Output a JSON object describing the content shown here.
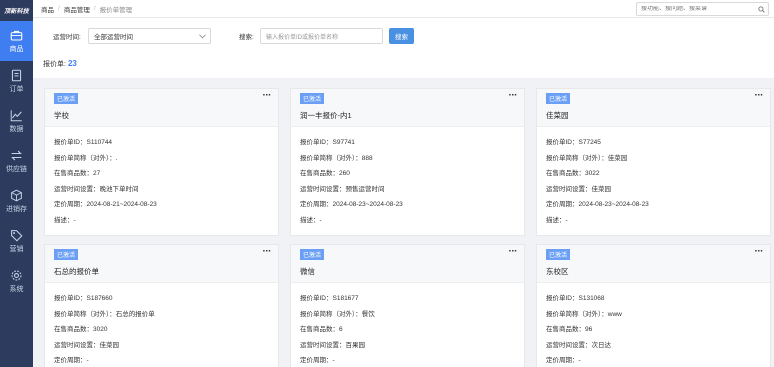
{
  "sidebar": {
    "logo": "顶新科技",
    "items": [
      {
        "label": "商品",
        "icon": "briefcase-icon",
        "active": true
      },
      {
        "label": "订单",
        "icon": "document-icon",
        "active": false
      },
      {
        "label": "数据",
        "icon": "line-chart-icon",
        "active": false
      },
      {
        "label": "供应链",
        "icon": "swap-icon",
        "active": false
      },
      {
        "label": "进销存",
        "icon": "box-icon",
        "active": false
      },
      {
        "label": "营销",
        "icon": "tag-icon",
        "active": false
      },
      {
        "label": "系统",
        "icon": "gear-icon",
        "active": false
      }
    ]
  },
  "breadcrumb": [
    "商品",
    "商品管理",
    "报价单管理"
  ],
  "top_search": {
    "placeholder": "搜功能、搜问题、搜菜谱"
  },
  "filters": {
    "period_label": "运营时间:",
    "period_value": "全部运营时间",
    "search_label": "搜索:",
    "search_placeholder": "输入报价单ID或报价单名称",
    "search_button": "搜索"
  },
  "count": {
    "label": "报价单:",
    "value": "23"
  },
  "cards": [
    {
      "status": "已激活",
      "more": "···",
      "title": "学校",
      "rows": [
        "报价单ID：S110744",
        "报价单简称（对外）：.",
        "在售商品数：27",
        "运营时间设置：晚池下单时间",
        "定价周期：2024-08-21~2024-08-23",
        "描述：-"
      ]
    },
    {
      "status": "已激活",
      "more": "···",
      "title": "润一丰报价-内1",
      "rows": [
        "报价单ID：S97741",
        "报价单简称（对外）：888",
        "在售商品数：260",
        "运营时间设置：预售运营时间",
        "定价周期：2024-08-23~2024-08-23",
        "描述：-"
      ]
    },
    {
      "status": "已激活",
      "more": "···",
      "title": "佳菜园",
      "rows": [
        "报价单ID：S77245",
        "报价单简称（对外）：佳菜园",
        "在售商品数：3022",
        "运营时间设置：佳菜园",
        "定价周期：2024-08-23~2024-08-23",
        "描述：-"
      ]
    },
    {
      "status": "已激活",
      "more": "···",
      "title": "石总的报价单",
      "rows": [
        "报价单ID：S187660",
        "报价单简称（对外）：石总的报价单",
        "在售商品数：3020",
        "运营时间设置：佳菜园",
        "定价周期：-"
      ]
    },
    {
      "status": "已激活",
      "more": "···",
      "title": "微信",
      "rows": [
        "报价单ID：S181677",
        "报价单简称（对外）：餐饮",
        "在售商品数：6",
        "运营时间设置：百果园",
        "定价周期：-"
      ]
    },
    {
      "status": "已激活",
      "more": "···",
      "title": "东校区",
      "rows": [
        "报价单ID：S131068",
        "报价单简称（对外）：www",
        "在售商品数：96",
        "运营时间设置：次日达",
        "定价周期：-"
      ]
    }
  ]
}
